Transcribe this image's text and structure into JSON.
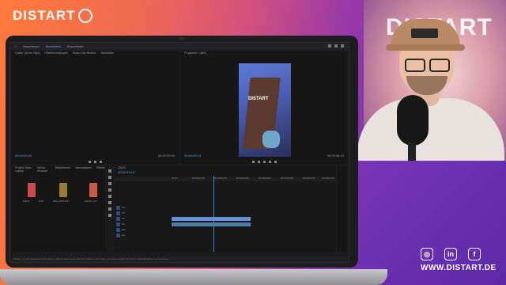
{
  "brand": {
    "name": "DISTART"
  },
  "backdrop": {
    "wall_text": "DISTART"
  },
  "social": {
    "icons": [
      "instagram-icon",
      "linkedin-icon",
      "facebook-icon"
    ],
    "website": "WWW.DISTART.DE"
  },
  "premiere": {
    "workspace_tabs": [
      "Importieren",
      "Bearbeiten",
      "Exportieren"
    ],
    "active_tab": "Bearbeiten",
    "source_panel_tabs": [
      "Quelle: (keine Clips)",
      "Effekteinstellungen",
      "Audio-Clip-Mischer",
      "Metadaten"
    ],
    "program_panel_tab": "Programm: Clip01",
    "source_timecode": "00:00:00:00",
    "source_timecode_end": "00:00:00:00",
    "program_timecode": "00:00:03:13",
    "program_duration": "00:00:08:15",
    "video_overlay_text": "DISTART",
    "project_tabs": [
      "Projekt: Main-Laptop",
      "Media-Browser",
      "Bibliotheken",
      "Informationen",
      "Effekte"
    ],
    "project_items": [
      {
        "name": "Clip01",
        "meta": "8:15"
      },
      {
        "name": "IMG_2352.JPG",
        "meta": ""
      },
      {
        "name": "Clip01.mp4",
        "meta": ""
      }
    ],
    "timeline_tab": "Clip01",
    "timeline_timecode": "00:00:03:13",
    "ruler_labels": [
      "00:00",
      "00:00:01:00",
      "00:00:02:00",
      "00:00:03:00",
      "00:00:04:00",
      "00:00:05:00",
      "00:00:06:00",
      "00:00:07:00"
    ],
    "video_tracks": [
      "V3",
      "V2",
      "V1"
    ],
    "audio_tracks": [
      "A1",
      "A2",
      "A3"
    ],
    "status_text": "Klicken, um die Auswahl vorzunehmen, oder in einem leeren Bereich klicken und ziehen, um eine Auswahl mit einem Auswahlrahmen vorzunehmen."
  }
}
